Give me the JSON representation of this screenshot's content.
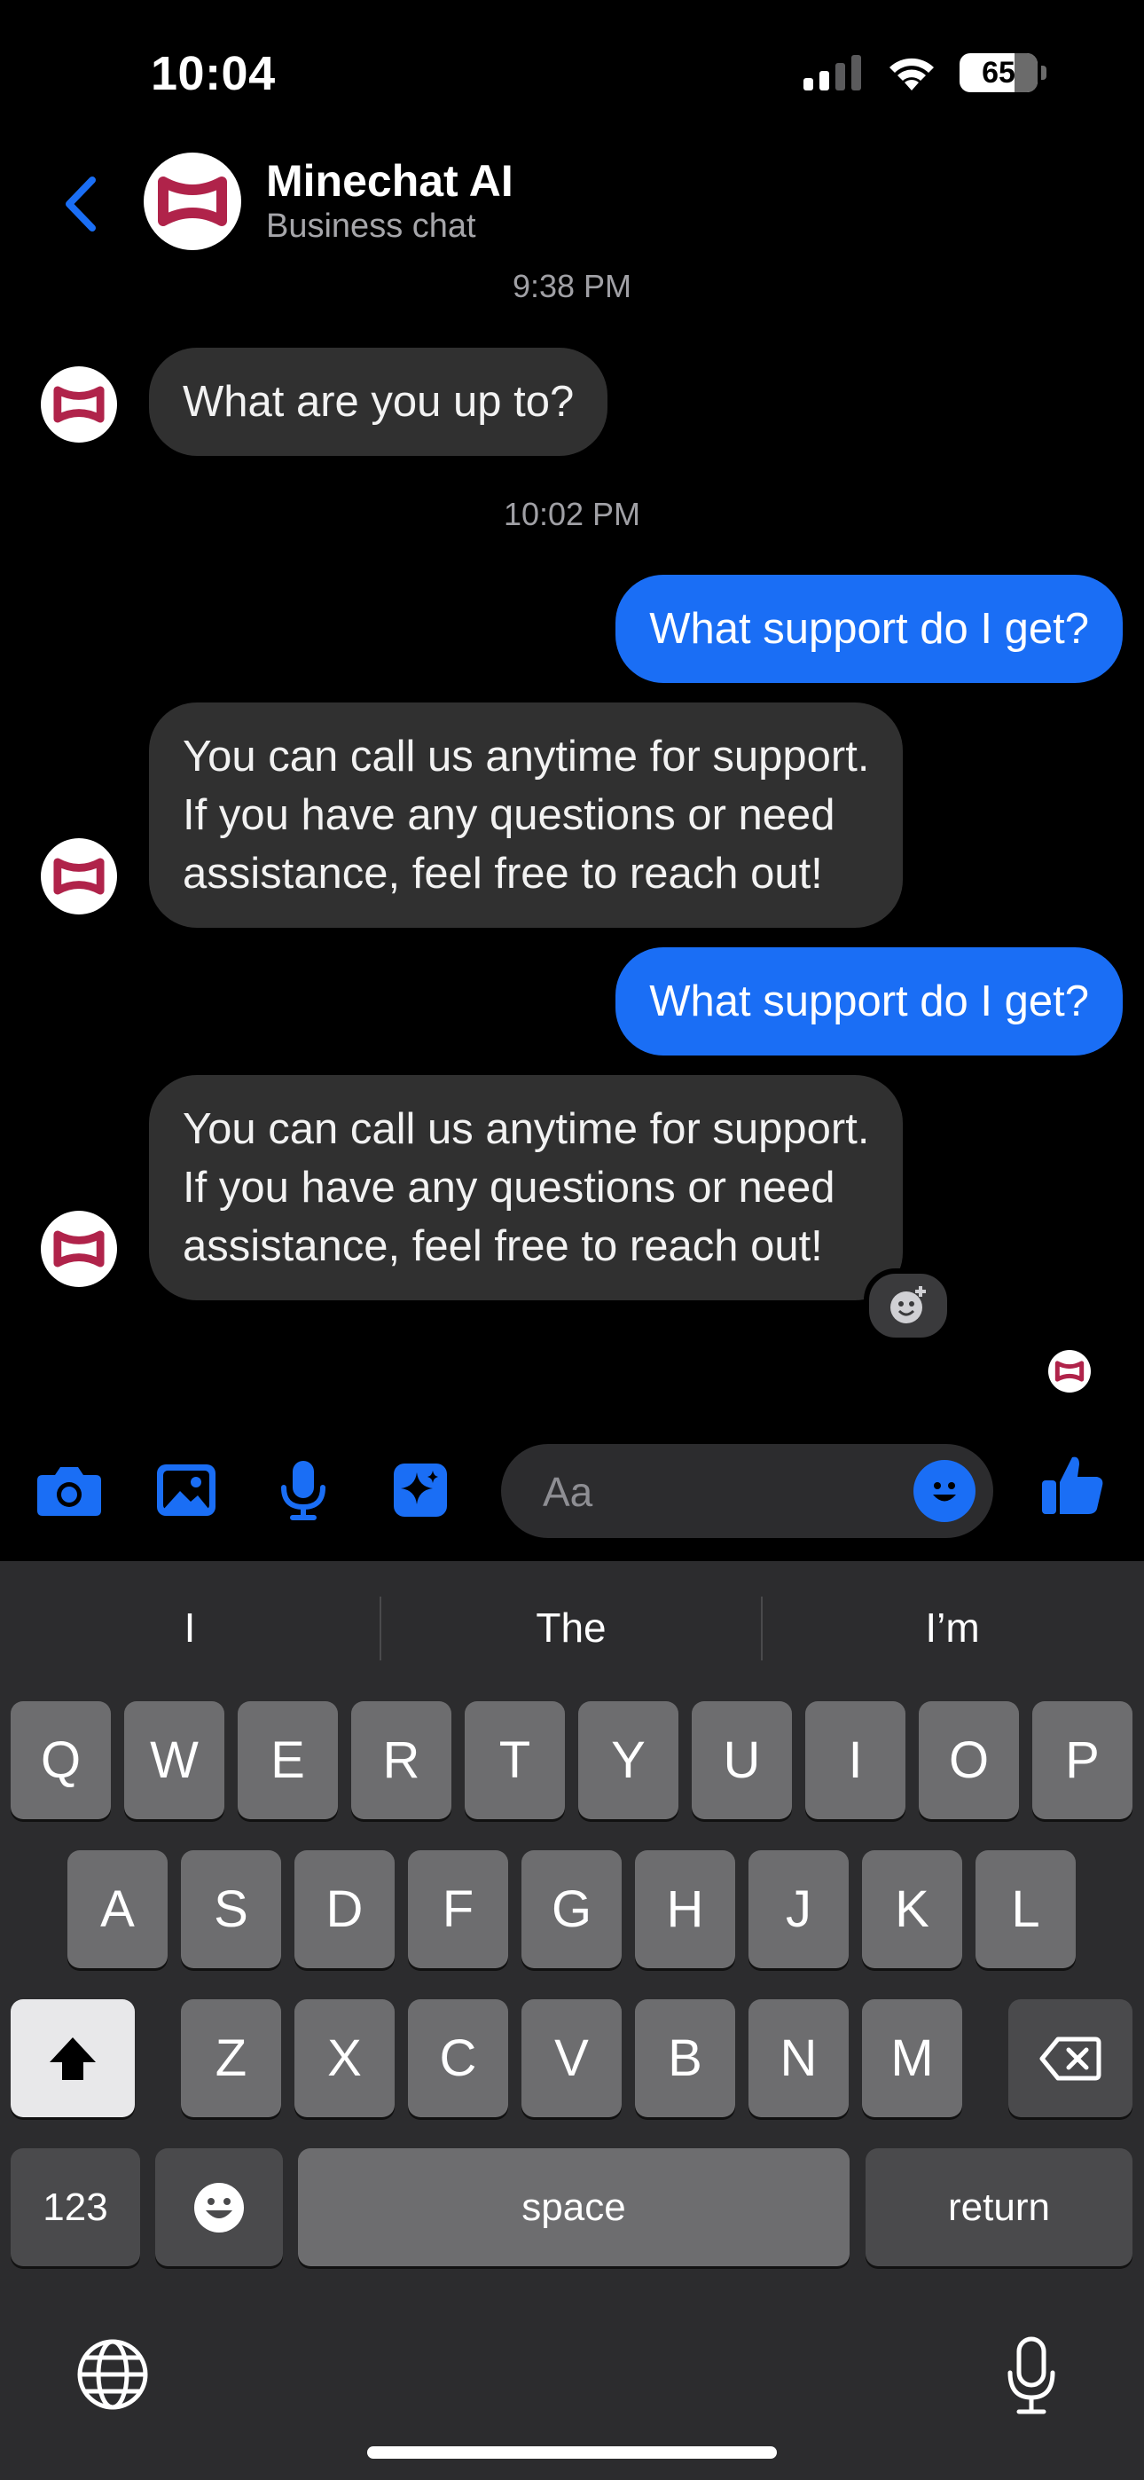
{
  "status_bar": {
    "time": "10:04",
    "battery": "65"
  },
  "header": {
    "title": "Minechat AI",
    "subtitle": "Business chat"
  },
  "messages": [
    {
      "type": "timestamp",
      "text": "9:38 PM"
    },
    {
      "type": "incoming",
      "text": "What are you up to?"
    },
    {
      "type": "timestamp",
      "text": "10:02 PM"
    },
    {
      "type": "outgoing",
      "text": "What support do I get?"
    },
    {
      "type": "incoming",
      "lines": [
        "You can call us anytime for support.",
        "If you have any questions or need",
        "assistance, feel free to reach out!"
      ]
    },
    {
      "type": "outgoing",
      "text": "What support do I get?"
    },
    {
      "type": "incoming",
      "lines": [
        "You can call us anytime for support.",
        "If you have any questions or need",
        "assistance, feel free to reach out!"
      ]
    }
  ],
  "composer": {
    "icons": [
      "camera-icon",
      "photo-icon",
      "microphone-icon",
      "sparkle-icon",
      "emoji-icon",
      "thumbs-up-icon"
    ],
    "placeholder": "Aa"
  },
  "keyboard": {
    "suggestions": [
      "I",
      "The",
      "I’m"
    ],
    "row1": [
      "Q",
      "W",
      "E",
      "R",
      "T",
      "Y",
      "U",
      "I",
      "O",
      "P"
    ],
    "row2": [
      "A",
      "S",
      "D",
      "F",
      "G",
      "H",
      "J",
      "K",
      "L"
    ],
    "row3": [
      "Z",
      "X",
      "C",
      "V",
      "B",
      "N",
      "M"
    ],
    "numbers_label": "123",
    "space_label": "space",
    "return_label": "return"
  },
  "colors": {
    "accent": "#1a6ef5",
    "incoming_bubble": "#303030",
    "brand": "#b0234a"
  }
}
